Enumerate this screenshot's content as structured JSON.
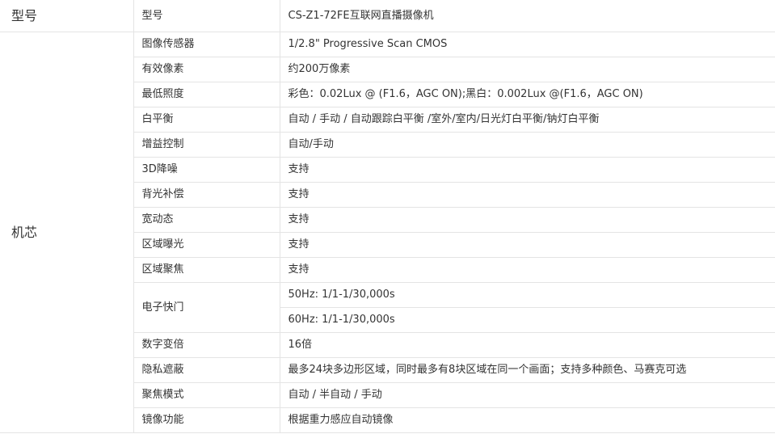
{
  "model_row": {
    "group": "型号",
    "label": "型号",
    "value": "CS-Z1-72FE互联网直播摄像机"
  },
  "chip_section": {
    "group": "机芯",
    "rows": [
      {
        "label": "图像传感器",
        "value": "1/2.8\" Progressive Scan CMOS"
      },
      {
        "label": "有效像素",
        "value": "约200万像素"
      },
      {
        "label": "最低照度",
        "value": "彩色：0.02Lux @ (F1.6，AGC ON);黑白：0.002Lux @(F1.6，AGC ON)"
      },
      {
        "label": "白平衡",
        "value": "自动 / 手动 / 自动跟踪白平衡 /室外/室内/日光灯白平衡/钠灯白平衡"
      },
      {
        "label": "增益控制",
        "value": "自动/手动"
      },
      {
        "label": "3D降噪",
        "value": "支持"
      },
      {
        "label": "背光补偿",
        "value": "支持"
      },
      {
        "label": "宽动态",
        "value": "支持"
      },
      {
        "label": "区域曝光",
        "value": "支持"
      },
      {
        "label": "区域聚焦",
        "value": "支持"
      }
    ],
    "shutter": {
      "label": "电子快门",
      "values": [
        "50Hz: 1/1-1/30,000s",
        "60Hz: 1/1-1/30,000s"
      ]
    },
    "rows_after": [
      {
        "label": "数字变倍",
        "value": "16倍"
      },
      {
        "label": "隐私遮蔽",
        "value": "最多24块多边形区域，同时最多有8块区域在同一个画面；支持多种颜色、马赛克可选"
      },
      {
        "label": "聚焦模式",
        "value": "自动 / 半自动 / 手动"
      },
      {
        "label": "镜像功能",
        "value": "根据重力感应自动镜像"
      }
    ]
  }
}
